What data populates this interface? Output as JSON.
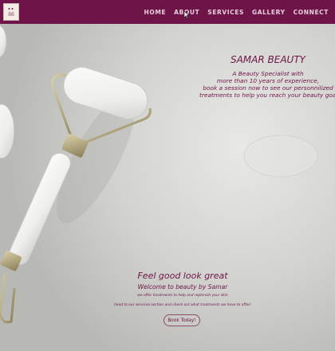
{
  "nav": {
    "items": [
      {
        "label": "HOME"
      },
      {
        "label": "ABOUT"
      },
      {
        "label": "SERVICES"
      },
      {
        "label": "GALLERY"
      },
      {
        "label": "CONNECT"
      }
    ]
  },
  "hero": {
    "brand": "SAMAR BEAUTY",
    "tagline_1": "A Beauty Specialist with",
    "tagline_2": "more than 10 years of experience,",
    "tagline_3": "book a session now to see our personnilized",
    "tagline_4": "treatments to help you reach your beauty goal!"
  },
  "promo": {
    "headline": "Feel good look great",
    "subheadline": "Welcome to beauty by Samar",
    "line_1": "we offer treatments to help and replenish your skin",
    "line_2": "head to our services section and check out what treatments we have to offer!",
    "button_label": "Book Today!"
  },
  "colors": {
    "navbar": "#6e1448",
    "accent_text": "#6e1448",
    "nav_text": "#e9cfdc",
    "background": "#d4d4d1"
  }
}
